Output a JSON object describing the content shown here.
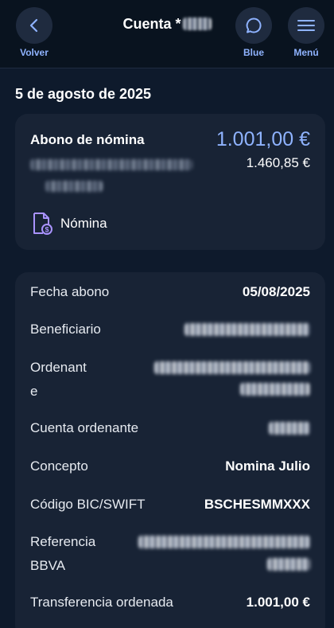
{
  "header": {
    "back_label": "Volver",
    "title": "Cuenta *",
    "chat_label": "Blue",
    "menu_label": "Menú"
  },
  "date_heading": "5 de agosto de 2025",
  "summary": {
    "title": "Abono de nómina",
    "amount": "1.001,00 €",
    "balance": "1.460,85 €",
    "category": "Nómina",
    "category_icon": "payroll-document-icon"
  },
  "details": {
    "fecha_label": "Fecha abono",
    "fecha_value": "05/08/2025",
    "beneficiario_label": "Beneficiario",
    "ordenante_label_1": "Ordenant",
    "ordenante_label_2": "e",
    "cuenta_ordenante_label": "Cuenta ordenante",
    "concepto_label": "Concepto",
    "concepto_value": "Nomina Julio",
    "bic_label": "Código BIC/SWIFT",
    "bic_value": "BSCHESMMXXX",
    "referencia_label_1": "Referencia",
    "referencia_label_2": "BBVA",
    "transferencia_label": "Transferencia ordenada",
    "transferencia_value": "1.001,00 €"
  },
  "colors": {
    "background": "#0e1a2c",
    "header": "#09131f",
    "card": "#182335",
    "accent": "#8fb3ff"
  }
}
